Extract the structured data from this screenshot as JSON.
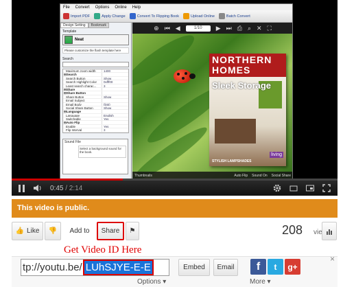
{
  "app": {
    "menu": [
      "File",
      "Convert",
      "Options",
      "Online",
      "Help"
    ],
    "toolbar": [
      "Import PDF",
      "Apply Change",
      "Convert To Flipping Book",
      "Upload Online",
      "Batch Convert"
    ],
    "tabs": [
      "Design Setting",
      "Bookmark"
    ],
    "template_label": "Template",
    "template_name": "Neat",
    "template_note": "Please customize the flash template here",
    "search_label": "Search",
    "properties": [
      {
        "k": "Maximum zoom width",
        "v": "1400",
        "grp": false
      },
      {
        "k": "⊟Search",
        "v": "",
        "grp": true
      },
      {
        "k": "Search Button",
        "v": "Show",
        "grp": false
      },
      {
        "k": "Search Highlight Color",
        "v": "0xfff00",
        "grp": false
      },
      {
        "k": "Least search charac...",
        "v": "3",
        "grp": false
      },
      {
        "k": "⊟Share",
        "v": "",
        "grp": true
      },
      {
        "k": "⊟Share Button",
        "v": "",
        "grp": true
      },
      {
        "k": "Share Button",
        "v": "Show",
        "grp": false
      },
      {
        "k": "Email Subject",
        "v": "",
        "grp": false
      },
      {
        "k": "Email Body",
        "v": "{link}",
        "grp": false
      },
      {
        "k": "Social Share Button",
        "v": "Show",
        "grp": false
      },
      {
        "k": "⊟Language",
        "v": "",
        "grp": true
      },
      {
        "k": "Language",
        "v": "English",
        "grp": false
      },
      {
        "k": "Switchable",
        "v": "Yes",
        "grp": false
      },
      {
        "k": "⊟Auto Flip",
        "v": "",
        "grp": true
      },
      {
        "k": "Enable",
        "v": "Yes",
        "grp": false
      },
      {
        "k": "Flip Interval",
        "v": "3",
        "grp": false
      }
    ],
    "sound_title": "Sound File",
    "sound_desc": "Select a background sound for the book.",
    "viewer": {
      "page_field": "1/10"
    },
    "magazine": {
      "title": "NORTHERN HOMES",
      "headline": "Sleek Storage",
      "footer": "STYLISH LAMPSHADES",
      "badge": "living"
    },
    "bottom_bar": {
      "thumbnails": "Thumbnails",
      "auto_flip": "Auto Flip",
      "sound": "Sound On",
      "social": "Social Share"
    }
  },
  "player": {
    "current_time": "0:45",
    "duration": "/ 2:14",
    "progress": 0.34
  },
  "banner": "This video is public.",
  "actions": {
    "like": "Like",
    "add_to": "Add to",
    "share": "Share",
    "views_count": "208",
    "views_label": "views"
  },
  "caption": "Get Video ID Here",
  "share": {
    "url_prefix": "tp://youtu.be/",
    "video_id": "LUhSJYE-E-E",
    "options": "Options ▾",
    "embed": "Embed",
    "email": "Email",
    "more": "More ▾",
    "close": "×"
  },
  "colors": {
    "banner": "#e08b1b",
    "highlight_border": "#dd0000",
    "caption": "#e00000",
    "facebook": "#3b5998",
    "twitter": "#29a9e1",
    "googleplus": "#d73d32"
  }
}
